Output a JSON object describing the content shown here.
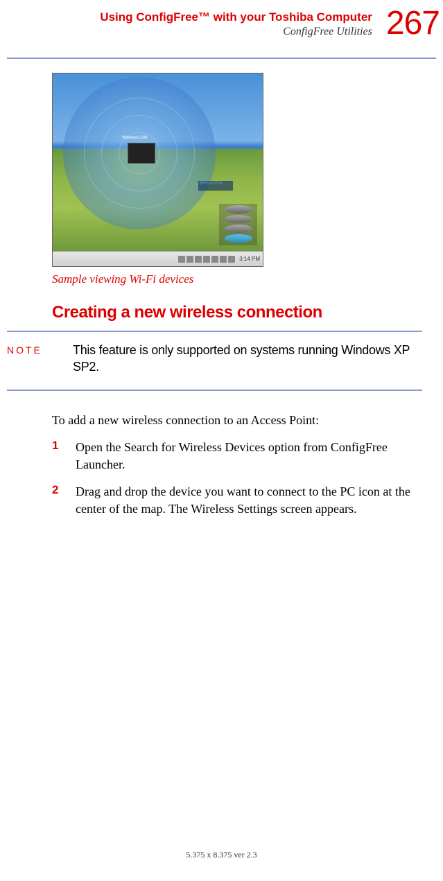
{
  "header": {
    "chapter": "Using ConfigFree™ with your Toshiba Computer",
    "section": "ConfigFree Utilities",
    "page_number": "267"
  },
  "figure": {
    "center_label": "Wireless LAN",
    "peer1": "BRIGANTIA",
    "taskbar_time": "3:14 PM",
    "caption": "Sample viewing Wi-Fi devices"
  },
  "section_heading": "Creating a new wireless connection",
  "note": {
    "label": "NOTE",
    "text": "This feature is only supported on systems running Windows XP SP2."
  },
  "intro": "To add a new wireless connection to an Access Point:",
  "steps": [
    {
      "num": "1",
      "text": "Open the Search for Wireless Devices option from ConfigFree Launcher."
    },
    {
      "num": "2",
      "text": "Drag and drop the device you want to connect to the PC icon at the center of the map. The Wireless Settings screen appears."
    }
  ],
  "footer": "5.375 x 8.375 ver 2.3"
}
